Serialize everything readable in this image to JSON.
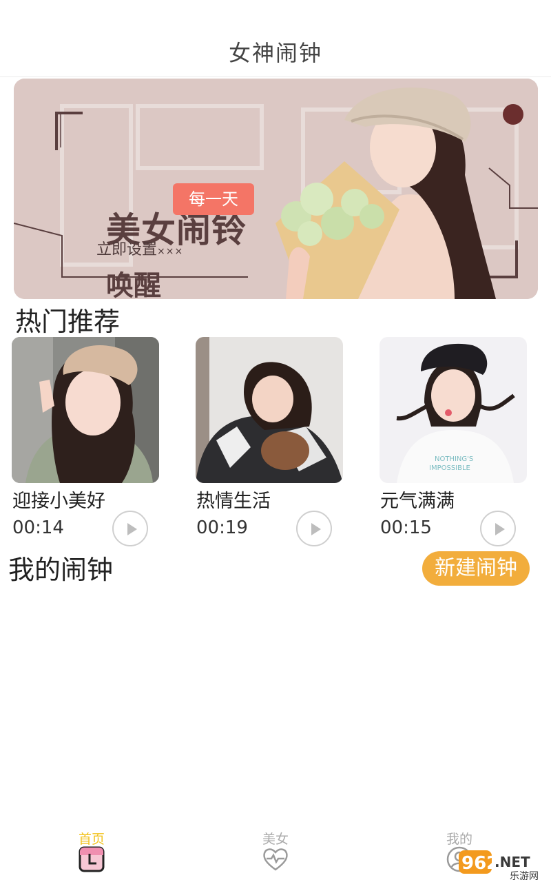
{
  "header": {
    "title": "女神闹钟"
  },
  "banner": {
    "title": "美女闹铃",
    "wake": "唤醒",
    "badge": "每一天",
    "setup": "立即设置",
    "dots": "×××"
  },
  "hot": {
    "title": "热门推荐",
    "items": [
      {
        "name": "迎接小美好",
        "duration": "00:14"
      },
      {
        "name": "热情生活",
        "duration": "00:19"
      },
      {
        "name": "元气满满",
        "duration": "00:15"
      }
    ]
  },
  "my_alarm": {
    "title": "我的闹钟",
    "new_button": "新建闹钟"
  },
  "tabbar": {
    "items": [
      {
        "label": "首页",
        "icon": "calendar-icon",
        "active": true
      },
      {
        "label": "美女",
        "icon": "heart-pulse-icon",
        "active": false
      },
      {
        "label": "我的",
        "icon": "person-icon",
        "active": false
      }
    ]
  },
  "watermark": {
    "text": "962.NET",
    "subtext": "乐游网"
  },
  "colors": {
    "accent": "#f2ad3c",
    "active_tab": "#f2c21c",
    "badge": "#f47566",
    "banner_bg": "#dcc8c4"
  }
}
